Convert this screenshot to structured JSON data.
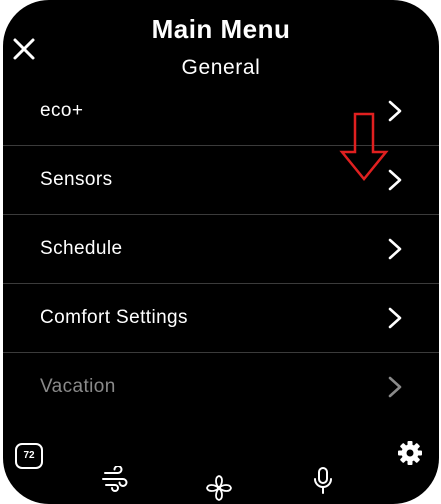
{
  "header": {
    "title": "Main Menu",
    "subtitle": "General"
  },
  "menu": {
    "items": [
      {
        "label": "eco+",
        "dimmed": false
      },
      {
        "label": "Sensors",
        "dimmed": false
      },
      {
        "label": "Schedule",
        "dimmed": false
      },
      {
        "label": "Comfort Settings",
        "dimmed": false
      },
      {
        "label": "Vacation",
        "dimmed": true
      }
    ]
  },
  "bottom_bar": {
    "temperature_badge": "72",
    "icons": [
      "wind-icon",
      "fan-icon",
      "microphone-icon",
      "gear-icon"
    ]
  },
  "annotation": {
    "arrow": "red-down-arrow",
    "color": "#e02020"
  },
  "colors": {
    "background": "#000000",
    "text": "#ffffff",
    "dimmed_text": "#8a8a8a",
    "divider": "#3b3b3b"
  }
}
